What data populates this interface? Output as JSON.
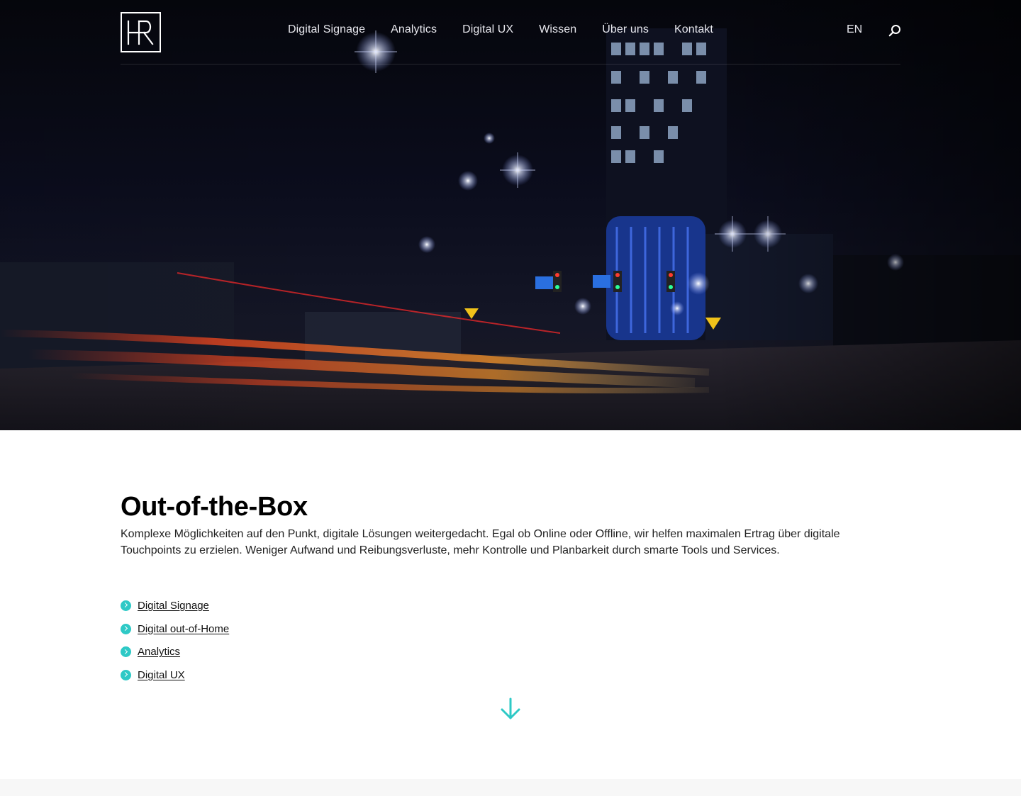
{
  "header": {
    "logo_text": "HR",
    "nav": [
      {
        "label": "Digital Signage"
      },
      {
        "label": "Analytics"
      },
      {
        "label": "Digital UX"
      },
      {
        "label": "Wissen"
      },
      {
        "label": "Über uns"
      },
      {
        "label": "Kontakt"
      }
    ],
    "language": "EN",
    "search_icon": "search-icon"
  },
  "hero": {
    "image": "night-city-street-light-trails"
  },
  "main": {
    "title": "Out-of-the-Box",
    "lead": "Komplexe Möglichkeiten auf den Punkt, digitale Lösungen weitergedacht. Egal ob Online oder Offline, wir helfen maximalen Ertrag über digitale Touchpoints zu erzielen. Weniger Aufwand und Reibungsverluste, mehr Kontrolle und Planbarkeit durch smarte Tools und Services.",
    "links": [
      {
        "label": "Digital Signage"
      },
      {
        "label": "Digital out-of-Home"
      },
      {
        "label": "Analytics"
      },
      {
        "label": "Digital UX"
      }
    ],
    "scroll_icon": "arrow-down-icon"
  },
  "colors": {
    "accent": "#2ec9c6",
    "hero_bg": "#0b0d1d",
    "text": "#222222"
  }
}
